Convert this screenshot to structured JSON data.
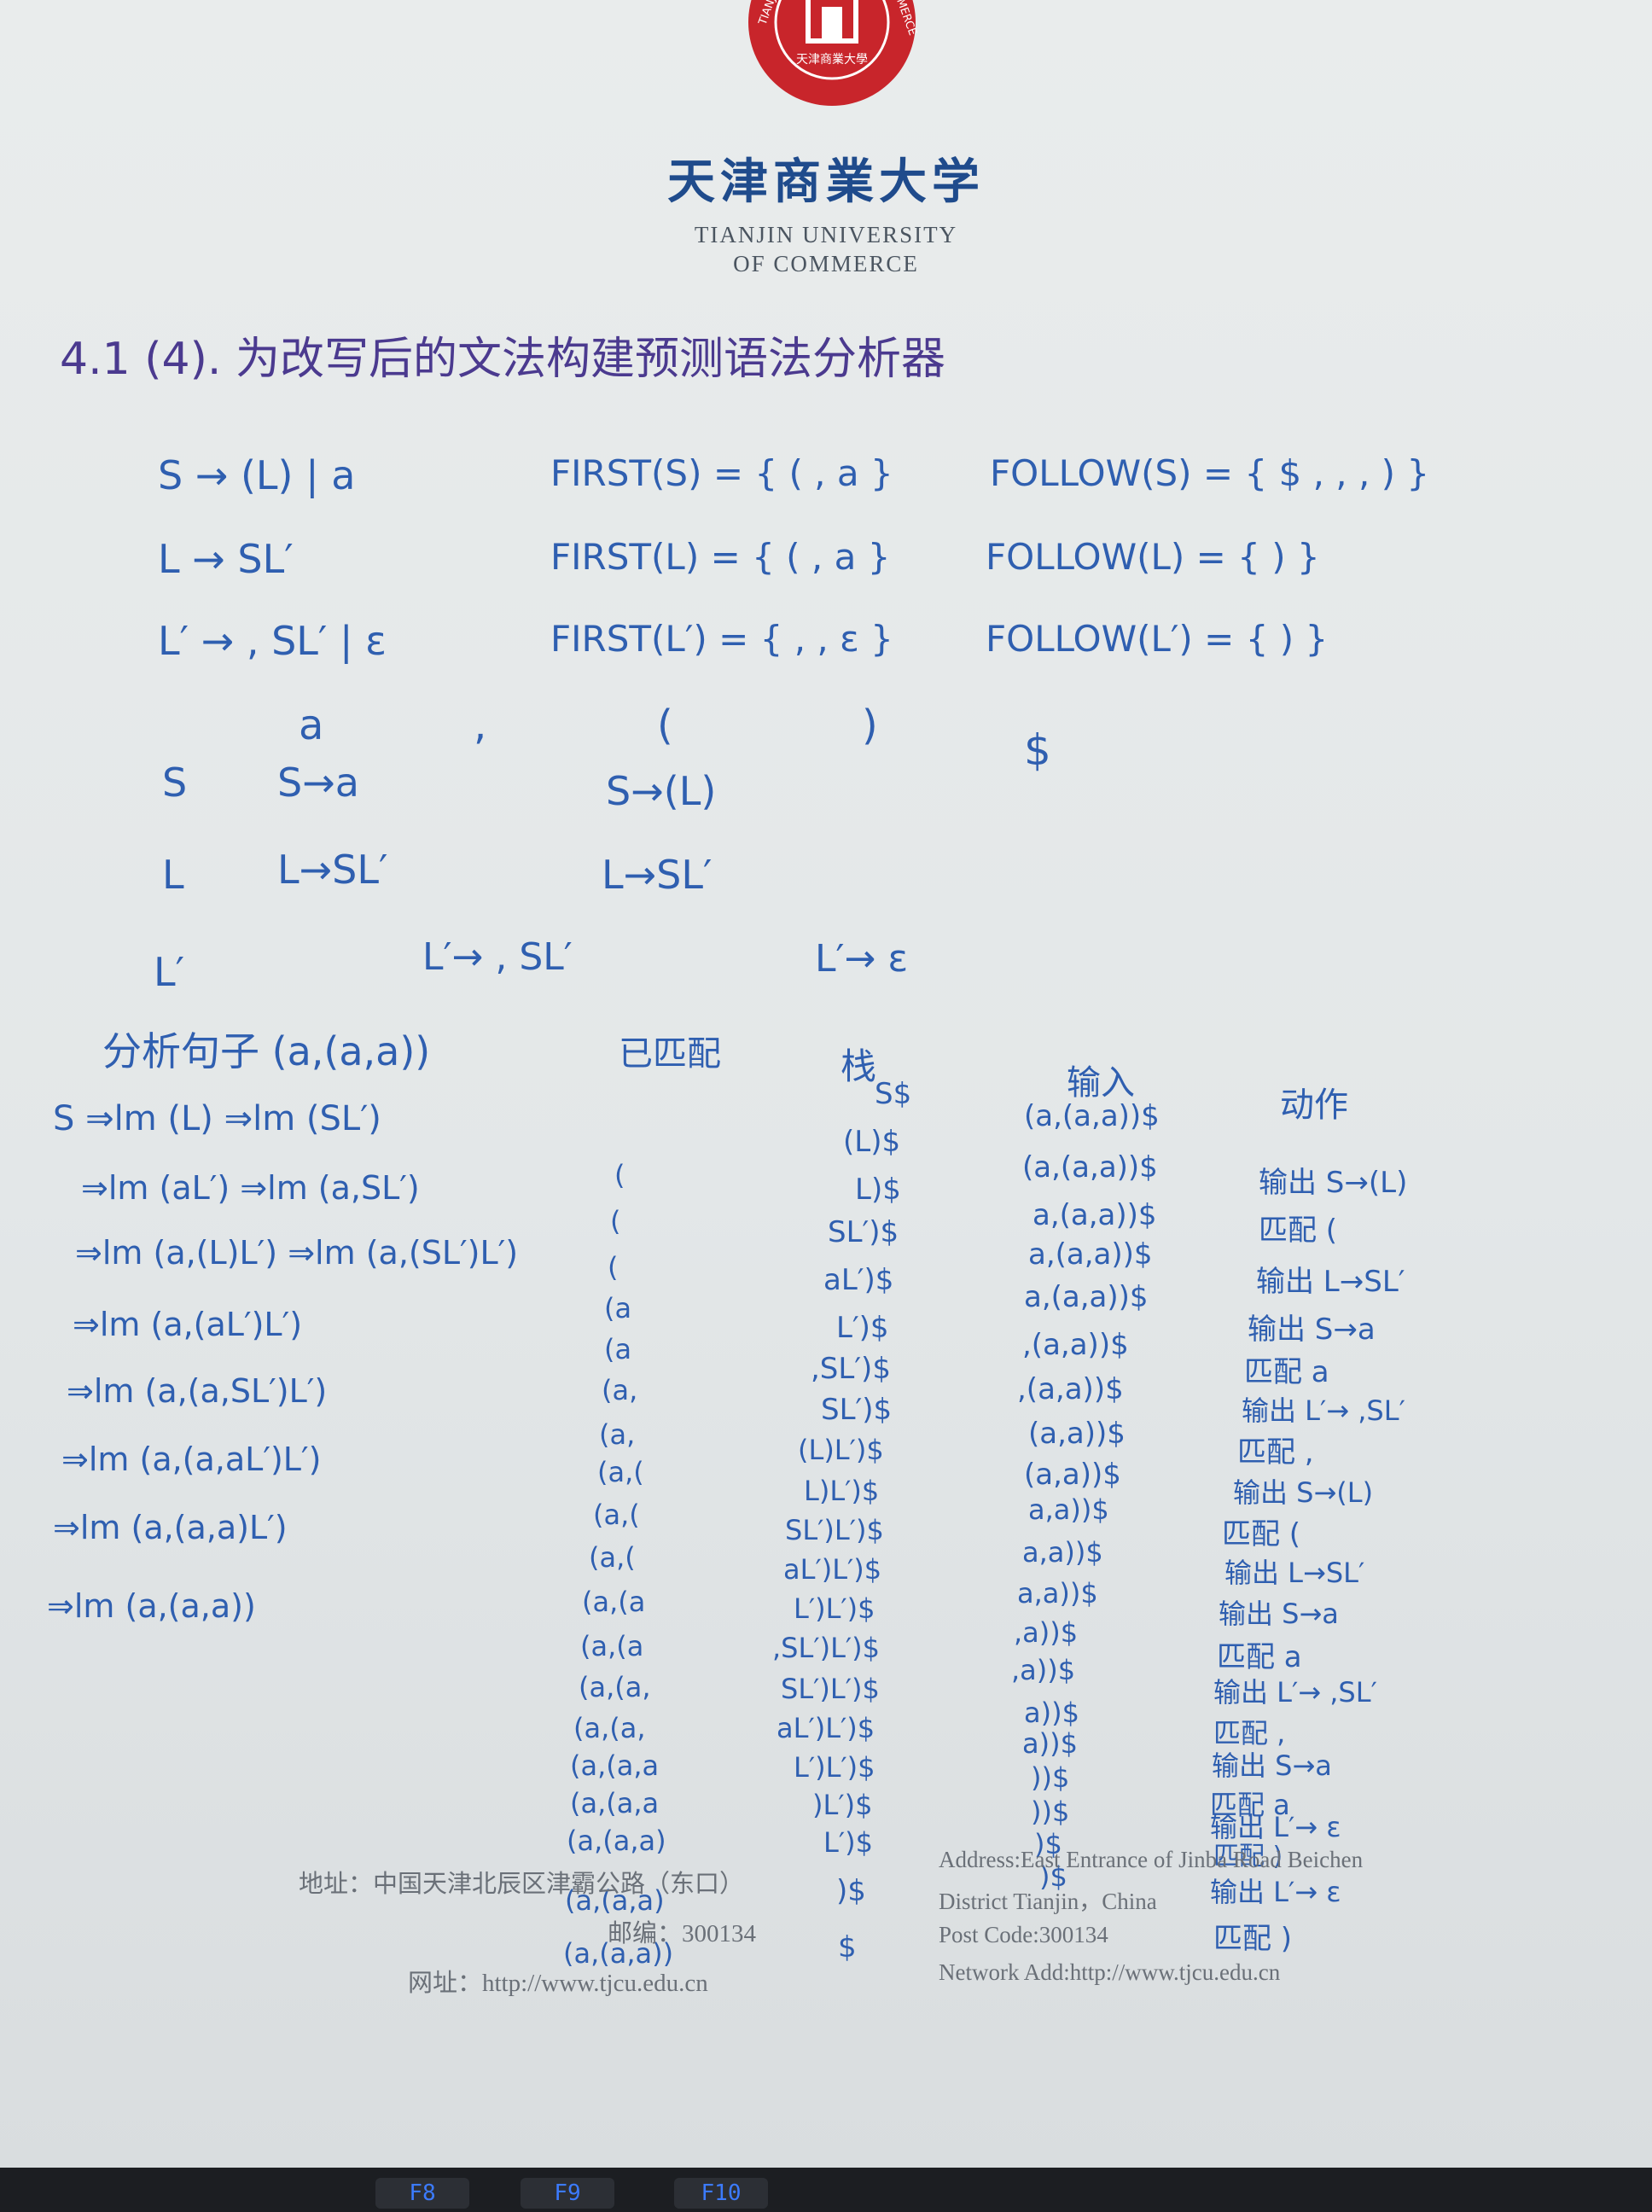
{
  "header": {
    "seal_ring_text_left": "TIANJIN",
    "seal_ring_text_right": "MERCE",
    "seal_inner_text": "天津商業大學",
    "university_cn": "天津商業大学",
    "university_en_1": "TIANJIN UNIVERSITY",
    "university_en_2": "OF COMMERCE"
  },
  "title": "4.1 (4). 为改写后的文法构建预测语法分析器",
  "grammar": [
    {
      "prod": "S → (L) | a",
      "first": "FIRST(S) = { ( , a }",
      "follow": "FOLLOW(S) = { $ , , , ) }"
    },
    {
      "prod": "L → SL′",
      "first": "FIRST(L) = { ( , a }",
      "follow": "FOLLOW(L) = { ) }"
    },
    {
      "prod": "L′ → , SL′ | ε",
      "first": "FIRST(L′) = { , , ε }",
      "follow": "FOLLOW(L′) = { ) }"
    }
  ],
  "table": {
    "headers": [
      "a",
      ",",
      "(",
      ")",
      "$"
    ],
    "rows": [
      {
        "nt": "S",
        "a": "S→a",
        "comma": "",
        "lp": "S→(L)",
        "rp": "",
        "end": ""
      },
      {
        "nt": "L",
        "a": "L→SL′",
        "comma": "",
        "lp": "L→SL′",
        "rp": "",
        "end": ""
      },
      {
        "nt": "L′",
        "a": "",
        "comma": "L′→ , SL′",
        "lp": "",
        "rp": "L′→ ε",
        "end": ""
      }
    ]
  },
  "analysis": {
    "heading": "分析句子 (a,(a,a))",
    "col_matched": "已匹配",
    "col_stack": "栈",
    "col_input": "输入",
    "col_action": "动作",
    "derivations": [
      "S ⇒lm (L) ⇒lm (SL′)",
      "⇒lm (aL′) ⇒lm (a,SL′)",
      "⇒lm (a,(L)L′) ⇒lm (a,(SL′)L′)",
      "⇒lm (a,(aL′)L′)",
      "⇒lm (a,(a,SL′)L′)",
      "⇒lm (a,(a,aL′)L′)",
      "⇒lm (a,(a,a)L′)",
      "⇒lm (a,(a,a))"
    ],
    "matched": [
      "(",
      "(",
      "(",
      "(a",
      "(a",
      "(a,",
      "(a,",
      "(a,(",
      "(a,(",
      "(a,(",
      "(a,(a",
      "(a,(a",
      "(a,(a,",
      "(a,(a,",
      "(a,(a,a",
      "(a,(a,a",
      "(a,(a,a)",
      "(a,(a,a)",
      "(a,(a,a))"
    ],
    "stack": [
      "S$",
      "(L)$",
      "L)$",
      "SL′)$",
      "aL′)$",
      "L′)$",
      ",SL′)$",
      "SL′)$",
      "(L)L′)$",
      "L)L′)$",
      "SL′)L′)$",
      "aL′)L′)$",
      "L′)L′)$",
      ",SL′)L′)$",
      "SL′)L′)$",
      "aL′)L′)$",
      "L′)L′)$",
      ")L′)$",
      "L′)$",
      ")$",
      "$"
    ],
    "input": [
      "(a,(a,a))$",
      "(a,(a,a))$",
      "a,(a,a))$",
      "a,(a,a))$",
      "a,(a,a))$",
      ",(a,a))$",
      ",(a,a))$",
      "(a,a))$",
      "(a,a))$",
      "a,a))$",
      "a,a))$",
      "a,a))$",
      ",a))$",
      ",a))$",
      "a))$",
      "a))$",
      "))$",
      "))$",
      ")$",
      ")$"
    ],
    "actions": [
      "输出 S→(L)",
      "匹配 (",
      "输出 L→SL′",
      "输出 S→a",
      "匹配 a",
      "输出 L′→ ,SL′",
      "匹配 ,",
      "输出 S→(L)",
      "匹配 (",
      "输出 L→SL′",
      "输出 S→a",
      "匹配 a",
      "输出 L′→ ,SL′",
      "匹配 ,",
      "输出 S→a",
      "匹配 a",
      "输出 L′→ ε",
      "匹配 )",
      "输出 L′→ ε",
      "匹配 )"
    ]
  },
  "footer": {
    "address_cn": "地址：中国天津北辰区津霸公路（东口）",
    "postcode_cn": "邮编：300134",
    "web_cn": "网址：http://www.tjcu.edu.cn",
    "address_en_1": "Address:East Entrance of Jinba Road Beichen",
    "address_en_2": "District Tianjin，China",
    "postcode_en": "Post Code:300134",
    "web_en": "Network Add:http://www.tjcu.edu.cn"
  },
  "keyboard_keys": [
    "F8",
    "F9",
    "F10"
  ],
  "colors": {
    "ink": "#2f5fb0",
    "title_ink": "#4b3a8f",
    "seal_red": "#c8252b",
    "logo_blue": "#1f4b8c"
  }
}
